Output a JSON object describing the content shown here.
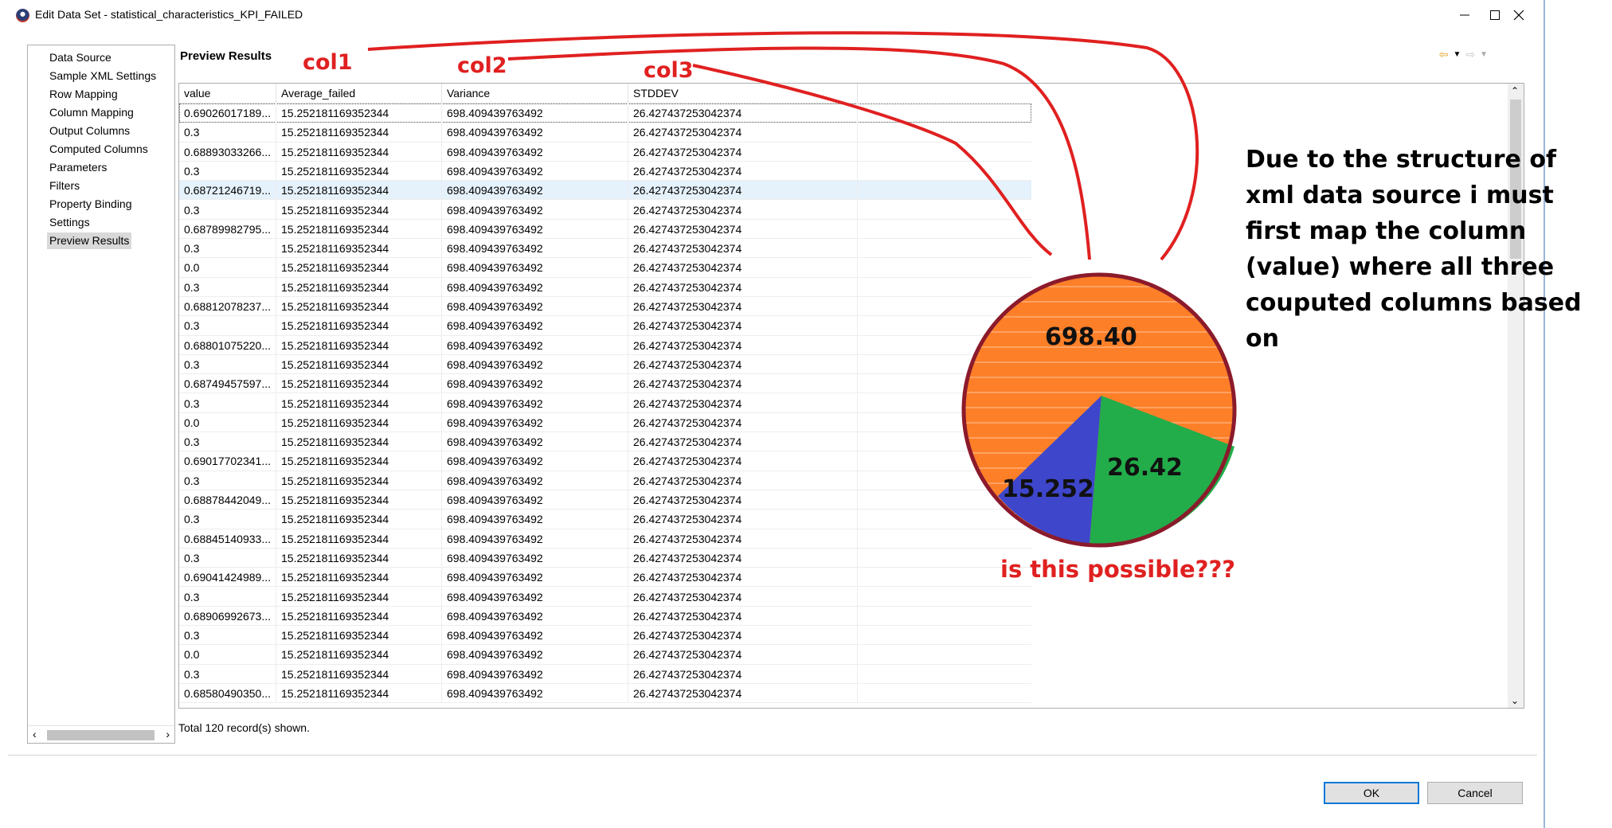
{
  "window": {
    "title": "Edit Data Set - statistical_characteristics_KPI_FAILED",
    "controls": [
      "minimize",
      "maximize",
      "close"
    ]
  },
  "nav": {
    "items": [
      {
        "label": "Data Source"
      },
      {
        "label": "Sample XML Settings"
      },
      {
        "label": "Row Mapping"
      },
      {
        "label": "Column Mapping"
      },
      {
        "label": "Output Columns"
      },
      {
        "label": "Computed Columns"
      },
      {
        "label": "Parameters"
      },
      {
        "label": "Filters"
      },
      {
        "label": "Property Binding"
      },
      {
        "label": "Settings"
      },
      {
        "label": "Preview Results"
      }
    ],
    "selected": "Preview Results"
  },
  "preview": {
    "title": "Preview Results",
    "columns": [
      "value",
      "Average_failed",
      "Variance",
      "STDDEV"
    ],
    "rows": [
      [
        "0.69026017189...",
        "15.252181169352344",
        "698.409439763492",
        "26.427437253042374"
      ],
      [
        "0.3",
        "15.252181169352344",
        "698.409439763492",
        "26.427437253042374"
      ],
      [
        "0.68893033266...",
        "15.252181169352344",
        "698.409439763492",
        "26.427437253042374"
      ],
      [
        "0.3",
        "15.252181169352344",
        "698.409439763492",
        "26.427437253042374"
      ],
      [
        "0.68721246719...",
        "15.252181169352344",
        "698.409439763492",
        "26.427437253042374"
      ],
      [
        "0.3",
        "15.252181169352344",
        "698.409439763492",
        "26.427437253042374"
      ],
      [
        "0.68789982795...",
        "15.252181169352344",
        "698.409439763492",
        "26.427437253042374"
      ],
      [
        "0.3",
        "15.252181169352344",
        "698.409439763492",
        "26.427437253042374"
      ],
      [
        "0.0",
        "15.252181169352344",
        "698.409439763492",
        "26.427437253042374"
      ],
      [
        "0.3",
        "15.252181169352344",
        "698.409439763492",
        "26.427437253042374"
      ],
      [
        "0.68812078237...",
        "15.252181169352344",
        "698.409439763492",
        "26.427437253042374"
      ],
      [
        "0.3",
        "15.252181169352344",
        "698.409439763492",
        "26.427437253042374"
      ],
      [
        "0.68801075220...",
        "15.252181169352344",
        "698.409439763492",
        "26.427437253042374"
      ],
      [
        "0.3",
        "15.252181169352344",
        "698.409439763492",
        "26.427437253042374"
      ],
      [
        "0.68749457597...",
        "15.252181169352344",
        "698.409439763492",
        "26.427437253042374"
      ],
      [
        "0.3",
        "15.252181169352344",
        "698.409439763492",
        "26.427437253042374"
      ],
      [
        "0.0",
        "15.252181169352344",
        "698.409439763492",
        "26.427437253042374"
      ],
      [
        "0.3",
        "15.252181169352344",
        "698.409439763492",
        "26.427437253042374"
      ],
      [
        "0.69017702341...",
        "15.252181169352344",
        "698.409439763492",
        "26.427437253042374"
      ],
      [
        "0.3",
        "15.252181169352344",
        "698.409439763492",
        "26.427437253042374"
      ],
      [
        "0.68878442049...",
        "15.252181169352344",
        "698.409439763492",
        "26.427437253042374"
      ],
      [
        "0.3",
        "15.252181169352344",
        "698.409439763492",
        "26.427437253042374"
      ],
      [
        "0.68845140933...",
        "15.252181169352344",
        "698.409439763492",
        "26.427437253042374"
      ],
      [
        "0.3",
        "15.252181169352344",
        "698.409439763492",
        "26.427437253042374"
      ],
      [
        "0.69041424989...",
        "15.252181169352344",
        "698.409439763492",
        "26.427437253042374"
      ],
      [
        "0.3",
        "15.252181169352344",
        "698.409439763492",
        "26.427437253042374"
      ],
      [
        "0.68906992673...",
        "15.252181169352344",
        "698.409439763492",
        "26.427437253042374"
      ],
      [
        "0.3",
        "15.252181169352344",
        "698.409439763492",
        "26.427437253042374"
      ],
      [
        "0.0",
        "15.252181169352344",
        "698.409439763492",
        "26.427437253042374"
      ],
      [
        "0.3",
        "15.252181169352344",
        "698.409439763492",
        "26.427437253042374"
      ],
      [
        "0.68580490350...",
        "15.252181169352344",
        "698.409439763492",
        "26.427437253042374"
      ]
    ],
    "selected_row_index": 0,
    "highlighted_row_index": 4,
    "status": "Total 120 record(s) shown."
  },
  "buttons": {
    "ok": "OK",
    "cancel": "Cancel"
  },
  "annotation": {
    "col_labels": [
      "col1",
      "col2",
      "col3"
    ],
    "note": "Due to the structure of xml data source i must first map the column (value) where all three couputed columns based on",
    "question": "is this possible???",
    "pie_labels": [
      "698.40",
      "15.252",
      "26.42"
    ],
    "colors": {
      "red": "#e02020",
      "orange": "#fd7f28",
      "blue": "#3e46cb",
      "green": "#22ad4a",
      "pie_border": "#8b1a2b"
    }
  }
}
